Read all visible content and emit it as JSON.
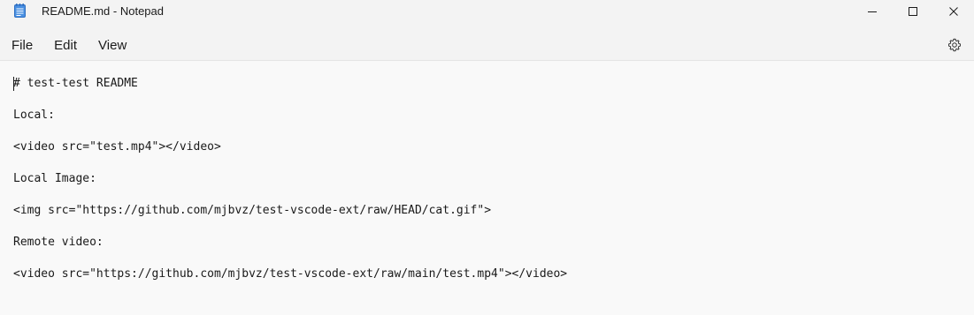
{
  "window": {
    "title": "README.md - Notepad",
    "app_icon": "notepad-icon",
    "controls": {
      "minimize_icon": "minimize-icon",
      "maximize_icon": "maximize-icon",
      "close_icon": "close-icon"
    }
  },
  "menu": {
    "items": [
      {
        "label": "File"
      },
      {
        "label": "Edit"
      },
      {
        "label": "View"
      }
    ],
    "settings_icon": "gear-icon"
  },
  "editor": {
    "lines": [
      "# test-test README",
      "Local:",
      "<video src=\"test.mp4\"></video>",
      "Local Image:",
      "<img src=\"https://github.com/mjbvz/test-vscode-ext/raw/HEAD/cat.gif\">",
      "Remote video:",
      "<video src=\"https://github.com/mjbvz/test-vscode-ext/raw/main/test.mp4\"></video>"
    ]
  },
  "colors": {
    "background": "#f9f9f9",
    "chrome": "#f3f3f3",
    "text": "#1a1a1a",
    "icon_blue": "#3b7fd6"
  }
}
